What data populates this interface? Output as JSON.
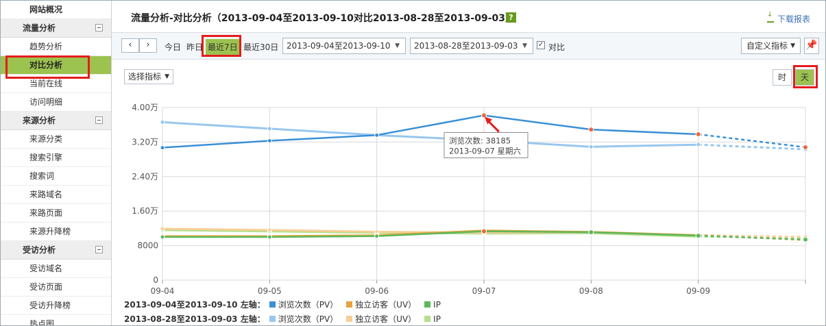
{
  "sidebar": {
    "overview": "网站概况",
    "groups": [
      {
        "title": "流量分析",
        "items": [
          "趋势分析",
          "对比分析",
          "当前在线",
          "访问明细"
        ]
      },
      {
        "title": "来源分析",
        "items": [
          "来源分类",
          "搜索引擎",
          "搜索词",
          "来路域名",
          "来路页面",
          "来源升降榜"
        ]
      },
      {
        "title": "受访分析",
        "items": [
          "受访域名",
          "受访页面",
          "受访升降榜",
          "热点图"
        ]
      }
    ],
    "active_item": "对比分析"
  },
  "header": {
    "title": "流量分析-对比分析（2013-09-04至2013-09-10对比2013-08-28至2013-09-03）",
    "help": "?",
    "download": "下载报表"
  },
  "toolbar": {
    "prev": "‹",
    "next": "›",
    "today": "今日",
    "yesterday": "昨日",
    "last7": "最近7日",
    "last30": "最近30日",
    "range1": "2013-09-04至2013-09-10",
    "range2": "2013-08-28至2013-09-03",
    "compare_checked": true,
    "compare_label": "对比",
    "custom_metric": "自定义指标",
    "pin_icon": "pin-icon"
  },
  "content": {
    "metric_select": "选择指标",
    "unit_hour": "时",
    "unit_day": "天",
    "unit_selected": "天"
  },
  "chart_data": {
    "type": "line",
    "categories": [
      "09-04",
      "09-05",
      "09-06",
      "09-07",
      "09-08",
      "09-09",
      "09-10"
    ],
    "x_tick_labels": [
      "09-04",
      "09-05",
      "09-06",
      "09-07",
      "09-08",
      "09-09"
    ],
    "ylim": [
      0,
      40000
    ],
    "y_ticks": [
      0,
      8000,
      16000,
      24000,
      32000,
      40000
    ],
    "y_tick_labels": [
      "0",
      "8000",
      "1.60万",
      "2.40万",
      "3.20万",
      "4.00万"
    ],
    "grid": true,
    "dashed_last_segment": true,
    "series": [
      {
        "name": "浏览次数（PV）",
        "group": "current",
        "color": "#3a8fd6",
        "values": [
          30700,
          32300,
          33600,
          38185,
          34900,
          33800,
          30800
        ]
      },
      {
        "name": "独立访客（UV）",
        "group": "current",
        "color": "#e8a33a",
        "values": [
          10200,
          10200,
          10400,
          11500,
          11200,
          10400,
          9300
        ]
      },
      {
        "name": "IP",
        "group": "current",
        "color": "#5cb85c",
        "values": [
          10000,
          10000,
          10200,
          11300,
          11100,
          10300,
          9400
        ]
      },
      {
        "name": "浏览次数（PV）",
        "group": "compare",
        "color": "#97c7ee",
        "values": [
          36600,
          35100,
          33600,
          32400,
          30900,
          31400,
          30300
        ]
      },
      {
        "name": "独立访客（UV）",
        "group": "compare",
        "color": "#f5cf96",
        "values": [
          11900,
          11600,
          11200,
          11000,
          11100,
          10400,
          10000
        ]
      },
      {
        "name": "IP",
        "group": "compare",
        "color": "#b3e08c",
        "values": [
          11600,
          11300,
          11000,
          10800,
          10900,
          10100,
          9800
        ]
      }
    ],
    "tooltip": {
      "series": "浏览次数（PV）",
      "category": "09-07",
      "line1": "浏览次数: 38185",
      "line2": "2013-09-07 星期六"
    },
    "legend": {
      "rows": [
        {
          "label": "2013-09-04至2013-09-10 左轴：",
          "group": "current"
        },
        {
          "label": "2013-08-28至2013-09-03 左轴：",
          "group": "compare"
        }
      ],
      "placement": "bottom"
    }
  }
}
